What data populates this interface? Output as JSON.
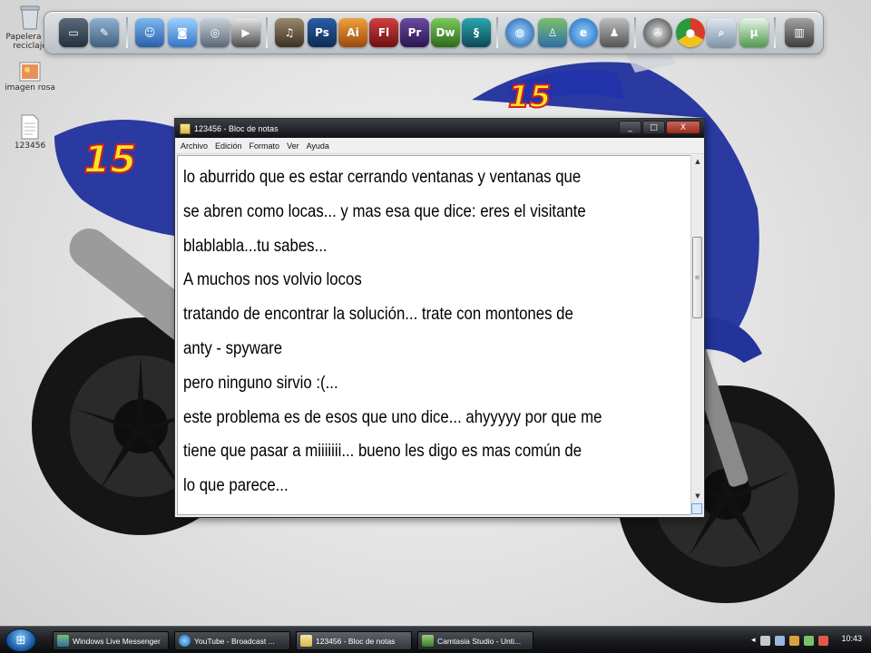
{
  "desktop": {
    "icons": [
      {
        "label": "Papelera de reciclaje",
        "icon": "recycle-bin-icon"
      },
      {
        "label": "imagen rosa",
        "icon": "image-file-icon"
      },
      {
        "label": "123456",
        "icon": "text-file-icon"
      }
    ]
  },
  "dock": {
    "icons": [
      "monitor-icon",
      "tools-icon",
      "finder-icon",
      "photos-icon",
      "dvd-icon",
      "video-icon",
      "headphones-icon",
      "photoshop-icon",
      "illustrator-icon",
      "flash-icon",
      "premiere-icon",
      "dreamweaver-icon",
      "3dsmax-icon",
      "globe-icon",
      "messenger-icon",
      "internet-explorer-icon",
      "user-icon",
      "film-reel-icon",
      "chrome-icon",
      "search-icon",
      "utorrent-icon",
      "trash-icon"
    ]
  },
  "window": {
    "title": "123456 - Bloc de notas",
    "buttons": {
      "minimize": "_",
      "maximize": "□",
      "close": "X"
    },
    "menu": [
      "Archivo",
      "Edición",
      "Formato",
      "Ver",
      "Ayuda"
    ],
    "content": [
      "lo aburrido que es estar cerrando ventanas y ventanas que",
      "se abren como locas... y mas esa que dice: eres el visitante",
      "blablabla...tu sabes...",
      "A muchos nos volvio locos",
      "tratando de encontrar la solución... trate con montones de",
      "anty - spyware",
      "pero ninguno sirvio :(...",
      "este problema es de esos que uno dice... ahyyyyy por que me",
      "tiene que pasar a miiiiiii... bueno les digo es mas común de",
      "lo que parece..."
    ]
  },
  "taskbar": {
    "items": [
      {
        "label": "Windows Live Messenger",
        "icon": "messenger-icon"
      },
      {
        "label": "YouTube - Broadcast ...",
        "icon": "internet-explorer-icon"
      },
      {
        "label": "123456 - Bloc de notas",
        "icon": "notepad-icon",
        "active": true
      },
      {
        "label": "Camtasia Studio - Unti...",
        "icon": "camtasia-icon"
      }
    ],
    "tray_icons": [
      "arrow-icon",
      "network-icon",
      "volume-icon",
      "shield-icon",
      "messenger-tray-icon",
      "camtasia-tray-icon",
      "update-icon"
    ],
    "clock": "10:43"
  },
  "colors": {
    "bike_blue": "#2a3aa0",
    "titlebar_dark": "#1b1d20",
    "taskbar_dark": "#1b1d20"
  }
}
